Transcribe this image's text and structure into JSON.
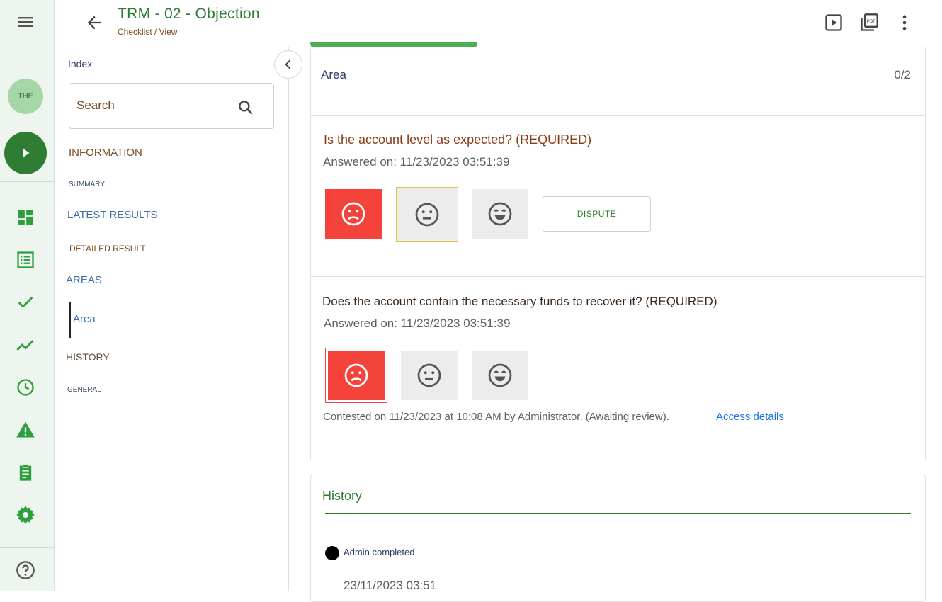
{
  "header": {
    "title": "TRM - 02 - Objection",
    "breadcrumb": "Checklist / View"
  },
  "rail": {
    "avatar": "THE"
  },
  "sidebar": {
    "index_label": "Index",
    "search_placeholder": "Search",
    "items": [
      {
        "label": "INFORMATION"
      },
      {
        "label": "SUMMARY"
      },
      {
        "label": "LATEST RESULTS"
      },
      {
        "label": "DETAILED RESULT"
      },
      {
        "label": "AREAS"
      },
      {
        "label": "Area"
      },
      {
        "label": "HISTORY"
      },
      {
        "label": "GENERAL"
      }
    ]
  },
  "area": {
    "name": "Area",
    "score": "0/2"
  },
  "questions": [
    {
      "text": "Is the account level as expected? (REQUIRED)",
      "answered": "Answered on: 11/23/2023 03:51:39",
      "dispute_label": "DISPUTE"
    },
    {
      "text": "Does the account contain the necessary funds to recover it? (REQUIRED)",
      "answered": "Answered on: 11/23/2023 03:51:39",
      "contested": "Contested on 11/23/2023 at 10:08 AM by Administrator. (Awaiting review).",
      "access_link": "Access details"
    }
  ],
  "history": {
    "title": "History",
    "entry_label": "Admin completed",
    "entry_date": "23/11/2023 03:51"
  },
  "colors": {
    "brand_green": "#2e7d32",
    "negative_red": "#f4433b",
    "link_blue": "#1a73e8",
    "label_brown": "#7a4a1e"
  }
}
